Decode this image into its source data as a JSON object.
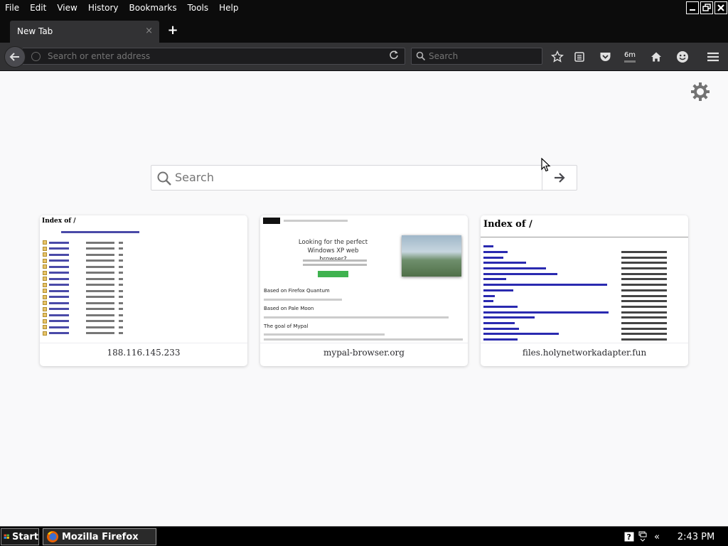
{
  "menubar": {
    "items": [
      "File",
      "Edit",
      "View",
      "History",
      "Bookmarks",
      "Tools",
      "Help"
    ]
  },
  "tab": {
    "title": "New Tab",
    "close": "×"
  },
  "newtab": {
    "label": "+"
  },
  "navbar": {
    "url_placeholder": "Search or enter address",
    "search_placeholder": "Search",
    "timer_badge": "6m"
  },
  "newtab_page": {
    "search_placeholder": "Search",
    "tiles": [
      {
        "label": "188.116.145.233",
        "preview_title": "Index of /"
      },
      {
        "label": "mypal-browser.org",
        "preview_heading": "Looking for the perfect Windows XP web browser?",
        "sections": [
          "Based on Firefox Quantum",
          "Based on Pale Moon",
          "The goal of Mypal"
        ]
      },
      {
        "label": "files.holynetworkadapter.fun",
        "preview_title": "Index of /"
      }
    ]
  },
  "taskbar": {
    "start": "Start",
    "task": "Mozilla Firefox",
    "chevron": "«",
    "clock": "2:43 PM"
  },
  "colors": {
    "chrome": "#323234",
    "page_bg": "#f9f9fa",
    "accent_green": "#3fb24f"
  }
}
